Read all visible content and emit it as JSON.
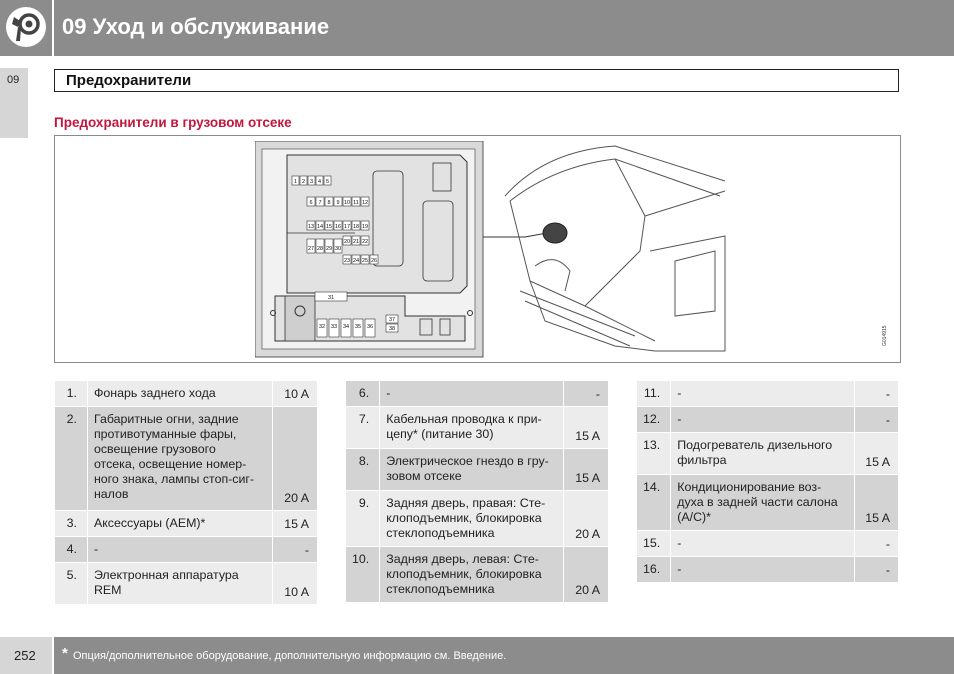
{
  "header": {
    "title": "09 Уход и обслуживание",
    "icon": "wrench-gear-icon"
  },
  "side_tab": {
    "label": "09"
  },
  "section": {
    "title": "Предохранители",
    "subtitle": "Предохранители в грузовом отсеке"
  },
  "figure": {
    "code": "G014915",
    "fuse_labels": {
      "row1": [
        "1",
        "2",
        "3",
        "4",
        "5"
      ],
      "row2": [
        "6",
        "7",
        "8",
        "9",
        "10",
        "11",
        "12"
      ],
      "row3": [
        "13",
        "14",
        "15",
        "16",
        "17",
        "18",
        "19"
      ],
      "row4a": [
        "27",
        "28",
        "29",
        "30"
      ],
      "row4b": [
        "20",
        "21",
        "22"
      ],
      "row5": [
        "23",
        "24",
        "25",
        "26"
      ],
      "relay": "31",
      "row6": [
        "32",
        "33",
        "34",
        "35",
        "36"
      ],
      "pair": [
        "37",
        "38"
      ]
    }
  },
  "tables": [
    {
      "rows": [
        {
          "num": "1.",
          "desc": "Фонарь заднего хода",
          "amp": "10 A"
        },
        {
          "num": "2.",
          "desc": "Габаритные огни, задние\nпротивотуманные фары,\nосвещение грузового\nотсека, освещение номер-\nного знака, лампы стоп-сиг-\nналов",
          "amp": "20 A"
        },
        {
          "num": "3.",
          "desc": "Аксессуары (AEM)*",
          "amp": "15 A"
        },
        {
          "num": "4.",
          "desc": "-",
          "amp": "-"
        },
        {
          "num": "5.",
          "desc": "Электронная аппаратура\nREM",
          "amp": "10 A"
        }
      ]
    },
    {
      "rows": [
        {
          "num": "6.",
          "desc": "-",
          "amp": "-"
        },
        {
          "num": "7.",
          "desc": "Кабельная проводка к при-\nцепу* (питание 30)",
          "amp": "15 A"
        },
        {
          "num": "8.",
          "desc": "Электрическое гнездо в гру-\nзовом отсеке",
          "amp": "15 A"
        },
        {
          "num": "9.",
          "desc": "Задняя дверь, правая: Сте-\nклоподъемник, блокировка\nстеклоподъемника",
          "amp": "20 A"
        },
        {
          "num": "10.",
          "desc": "Задняя дверь, левая: Сте-\nклоподъемник, блокировка\nстеклоподъемника",
          "amp": "20 A"
        }
      ]
    },
    {
      "rows": [
        {
          "num": "11.",
          "desc": "-",
          "amp": "-"
        },
        {
          "num": "12.",
          "desc": "-",
          "amp": "-"
        },
        {
          "num": "13.",
          "desc": "Подогреватель дизельного\nфильтра",
          "amp": "15 A"
        },
        {
          "num": "14.",
          "desc": "Кондиционирование воз-\nдуха в задней части салона\n(A/C)*",
          "amp": "15 A"
        },
        {
          "num": "15.",
          "desc": "-",
          "amp": "-"
        },
        {
          "num": "16.",
          "desc": "-",
          "amp": "-"
        }
      ]
    }
  ],
  "footer": {
    "page_number": "252",
    "star": "*",
    "note": "Опция/дополнительное оборудование, дополнительную информацию см. Введение."
  },
  "colors": {
    "header_gray": "#8c8c8c",
    "subtitle_red": "#c4163d",
    "row_light": "#ececec",
    "row_dark": "#d3d3d3"
  }
}
